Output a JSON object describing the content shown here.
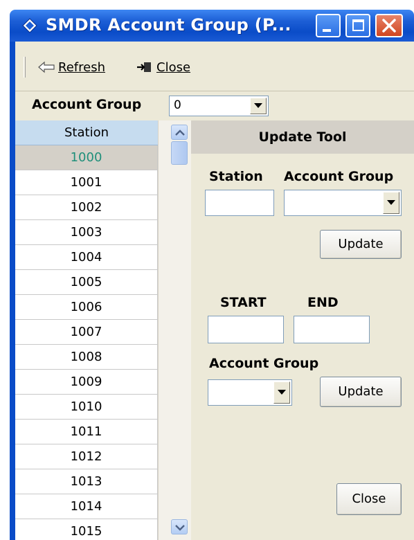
{
  "window": {
    "title": "SMDR Account Group (P...",
    "controls": [
      "minimize",
      "maximize",
      "close"
    ]
  },
  "toolbar": {
    "refresh_label": "Refresh",
    "close_label": "Close",
    "refresh_icon": "arrow-left-icon",
    "close_icon": "exit-door-icon"
  },
  "filter": {
    "label": "Account Group",
    "selected_value": "0"
  },
  "station_list": {
    "header": "Station",
    "rows": [
      "1000",
      "1001",
      "1002",
      "1003",
      "1004",
      "1005",
      "1006",
      "1007",
      "1008",
      "1009",
      "1010",
      "1011",
      "1012",
      "1013",
      "1014",
      "1015"
    ],
    "selected_index": 0
  },
  "update_tool": {
    "title": "Update Tool",
    "single": {
      "station_label": "Station",
      "account_group_label": "Account Group",
      "station_value": "",
      "account_group_value": "",
      "update_label": "Update"
    },
    "range": {
      "start_label": "START",
      "end_label": "END",
      "start_value": "",
      "end_value": "",
      "account_group_label": "Account Group",
      "account_group_value": "",
      "update_label": "Update"
    },
    "close_label": "Close"
  },
  "colors": {
    "titlebar": "#0a4cc8",
    "selected_row_text": "#1f8f7a",
    "list_header": "#c6dcef",
    "panel_bg": "#ece9d8"
  }
}
